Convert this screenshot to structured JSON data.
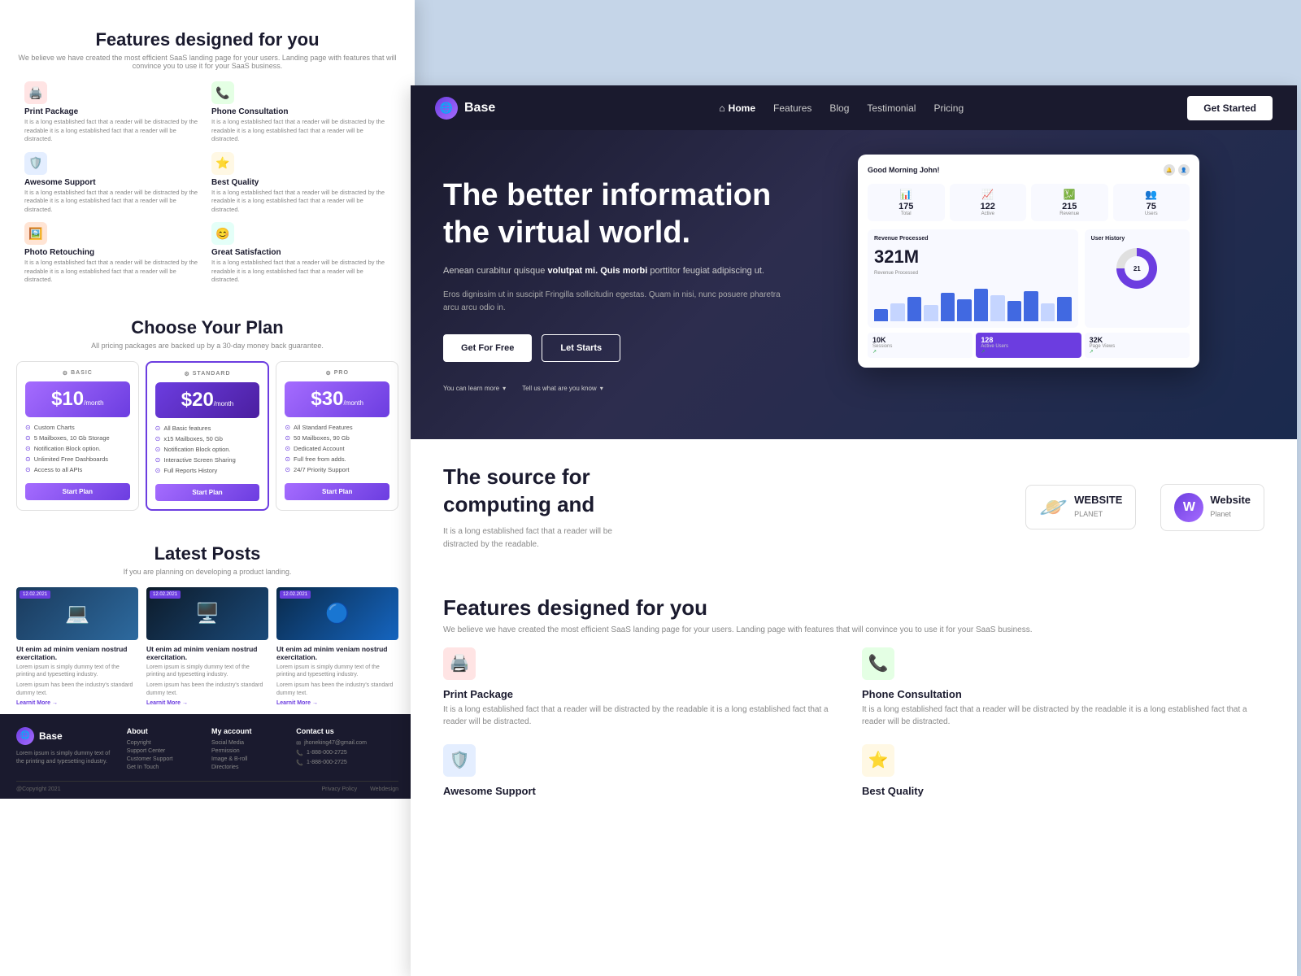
{
  "left": {
    "features_title": "Features designed for you",
    "features_sub": "We believe we have created the most efficient SaaS landing page for your users. Landing page with features that will convince you to use it for your SaaS business.",
    "features": [
      {
        "icon": "🖨️",
        "iconClass": "pink",
        "name": "print-package",
        "title": "Print Package",
        "desc": "It is a long established fact that a reader will be distracted by the readable it is a long established fact that a reader will be distracted."
      },
      {
        "icon": "📞",
        "iconClass": "green",
        "name": "phone-consultation",
        "title": "Phone Consultation",
        "desc": "It is a long established fact that a reader will be distracted by the readable it is a long established fact that a reader will be distracted."
      },
      {
        "icon": "🛡️",
        "iconClass": "blue",
        "name": "awesome-support",
        "title": "Awesome Support",
        "desc": "It is a long established fact that a reader will be distracted by the readable it is a long established fact that a reader will be distracted."
      },
      {
        "icon": "⭐",
        "iconClass": "yellow",
        "name": "best-quality",
        "title": "Best Quality",
        "desc": "It is a long established fact that a reader will be distracted by the readable it is a long established fact that a reader will be distracted."
      },
      {
        "icon": "🖼️",
        "iconClass": "orange",
        "name": "photo-retouching",
        "title": "Photo Retouching",
        "desc": "It is a long established fact that a reader will be distracted by the readable it is a long established fact that a reader will be distracted."
      },
      {
        "icon": "😊",
        "iconClass": "teal",
        "name": "great-satisfaction",
        "title": "Great Satisfaction",
        "desc": "It is a long established fact that a reader will be distracted by the readable it is a long established fact that a reader will be distracted."
      }
    ],
    "pricing_title": "Choose Your Plan",
    "pricing_sub": "All pricing packages are backed up by a 30-day money back guarantee.",
    "plans": [
      {
        "badge": "BASIC",
        "price": "$10",
        "per": "/month",
        "colorClass": "basic",
        "features": [
          "Custom Charts",
          "5 Mailboxes, 10 Gb Storage",
          "Notification Block option.",
          "Unlimited Free Dashboards",
          "Access to all APIs"
        ],
        "btn": "Start Plan"
      },
      {
        "badge": "STANDARD",
        "price": "$20",
        "per": "/month",
        "colorClass": "standard",
        "features": [
          "All Basic features",
          "x15 Mailboxes, 50 Gb",
          "Notification Block option.",
          "Interactive Screen Sharing",
          "Full Reports History"
        ],
        "btn": "Start Plan"
      },
      {
        "badge": "PRO",
        "price": "$30",
        "per": "/month",
        "colorClass": "pro",
        "features": [
          "All Standard Features",
          "50 Mailboxes, 90 Gb",
          "Dedicated Account",
          "Full free from adds.",
          "24/7 Priority Support"
        ],
        "btn": "Start Plan"
      }
    ],
    "posts_title": "Latest Posts",
    "posts_sub": "If you are planning on developing a product landing.",
    "posts": [
      {
        "date": "12.02.2021",
        "imgClass": "tech",
        "imgIcon": "💻",
        "title": "Ut enim ad minim veniam nostrud exercitation.",
        "excerpt": "Lorem ipsum is simply dummy text of the printing and typesetting industry.",
        "extra": "Lorem ipsum has been the industry's standard dummy text.",
        "link": "Learnit More →"
      },
      {
        "date": "12.02.2021",
        "imgClass": "server",
        "imgIcon": "🖥️",
        "title": "Ut enim ad minim veniam nostrud exercitation.",
        "excerpt": "Lorem ipsum is simply dummy text of the printing and typesetting industry.",
        "extra": "Lorem ipsum has been the industry's standard dummy text.",
        "link": "Learnit More →"
      },
      {
        "date": "12.02.2021",
        "imgClass": "data",
        "imgIcon": "🔵",
        "title": "Ut enim ad minim veniam nostrud exercitation.",
        "excerpt": "Lorem ipsum is simply dummy text of the printing and typesetting industry.",
        "extra": "Lorem ipsum has been the industry's standard dummy text.",
        "link": "Learnit More →"
      }
    ],
    "footer": {
      "brand_name": "Base",
      "brand_desc": "Lorem ipsum is simply dummy text of the printing and typesetting industry.",
      "about_title": "About",
      "about_links": [
        "Copyright",
        "Support Center",
        "Customer Support",
        "Get In Touch"
      ],
      "account_title": "My account",
      "account_links": [
        "Social Media",
        "Permission",
        "Image & B-roll",
        "Directories"
      ],
      "contact_title": "Contact us",
      "contact_email": "jhoneking47@gmail.com",
      "contact_phone1": "1-888-000-2725",
      "contact_phone2": "1-888-000-2725",
      "copyright": "@Copyright 2021",
      "privacy": "Privacy Policy",
      "webdesign": "Webdesign"
    }
  },
  "right": {
    "nav": {
      "brand": "Base",
      "links": [
        {
          "label": "Home",
          "active": true
        },
        {
          "label": "Features"
        },
        {
          "label": "Blog"
        },
        {
          "label": "Testimonial"
        },
        {
          "label": "Pricing"
        }
      ],
      "cta": "Get Started"
    },
    "hero": {
      "title": "The better information the virtual world.",
      "subtitle_plain": "Aenean curabitur quisque ",
      "subtitle_bold": "volutpat mi. Quis morbi",
      "subtitle_end": " porttitor feugiat adipiscing ut.",
      "desc": "Eros dignissim ut in suscipit Fringilla sollicitudin egestas. Quam in nisi, nunc posuere pharetra arcu arcu odio in.",
      "btn1": "Get For Free",
      "btn2": "Let Starts",
      "link1": "You can learn more",
      "link2": "Tell us what are you know"
    },
    "dashboard": {
      "greeting": "Good Morning John!",
      "stats": [
        {
          "icon": "📊",
          "num": "175",
          "label": "Total"
        },
        {
          "icon": "📈",
          "num": "122",
          "label": "Active"
        },
        {
          "icon": "💹",
          "num": "215",
          "label": "Revenue"
        },
        {
          "icon": "👥",
          "num": "75",
          "label": "Users"
        }
      ],
      "big_number": "321M",
      "big_label": "Revenue Processed",
      "bars": [
        30,
        45,
        60,
        40,
        70,
        55,
        80,
        65,
        50,
        75,
        45,
        60
      ],
      "mini_stats": [
        {
          "num": "10K",
          "label": "Sessions",
          "trend": "↗"
        },
        {
          "num": "128",
          "label": "Active Users",
          "trend": "↗"
        },
        {
          "num": "32K",
          "label": "Page Views",
          "trend": "↗"
        }
      ],
      "donut_val": "21",
      "user_history": "User History"
    },
    "source": {
      "title": "The source for computing and",
      "desc": "It is a long established fact that a reader will be distracted by the readable.",
      "logos": [
        {
          "icon": "🪐",
          "name": "WEBSITE",
          "sub": "PLANET"
        },
        {
          "icon": "W",
          "name": "Website",
          "sub": "Planet"
        }
      ]
    },
    "features": {
      "title": "Features designed for you",
      "sub": "We believe we have created the most efficient SaaS landing page for your users. Landing page with features that will convince you to use it for your SaaS business.",
      "items": [
        {
          "icon": "🖨️",
          "iconClass": "pink",
          "title": "Print Package",
          "desc": "It is a long established fact that a reader will be distracted by the readable it is a long established fact that a reader will be distracted."
        },
        {
          "icon": "📞",
          "iconClass": "green",
          "title": "Phone Consultation",
          "desc": "It is a long established fact that a reader will be distracted by the readable it is a long established fact that a reader will be distracted."
        },
        {
          "icon": "🛡️",
          "iconClass": "blue",
          "title": "Awesome Support",
          "desc": ""
        },
        {
          "icon": "⭐",
          "iconClass": "yellow",
          "title": "Best Quality",
          "desc": ""
        }
      ]
    }
  }
}
